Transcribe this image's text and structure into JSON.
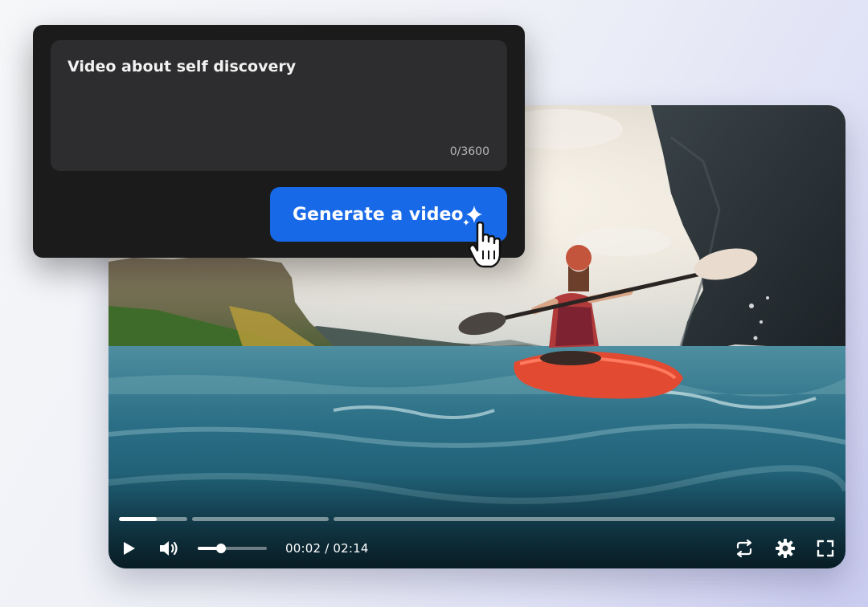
{
  "prompt": {
    "text": "Video about self discovery",
    "char_count": "0/3600"
  },
  "generate_button": {
    "label": "Generate a video",
    "color": "#1769e8"
  },
  "player": {
    "time_display": "00:02 / 02:14",
    "volume_level": 0.34,
    "progress_segments": [
      {
        "filled_fraction": 0.55
      },
      {
        "filled_fraction": 0
      },
      {
        "filled_fraction": 0
      }
    ],
    "icons": {
      "play": "play-icon",
      "volume": "volume-icon",
      "loop": "repeat-icon",
      "settings": "gear-icon",
      "fullscreen": "fullscreen-icon"
    }
  }
}
